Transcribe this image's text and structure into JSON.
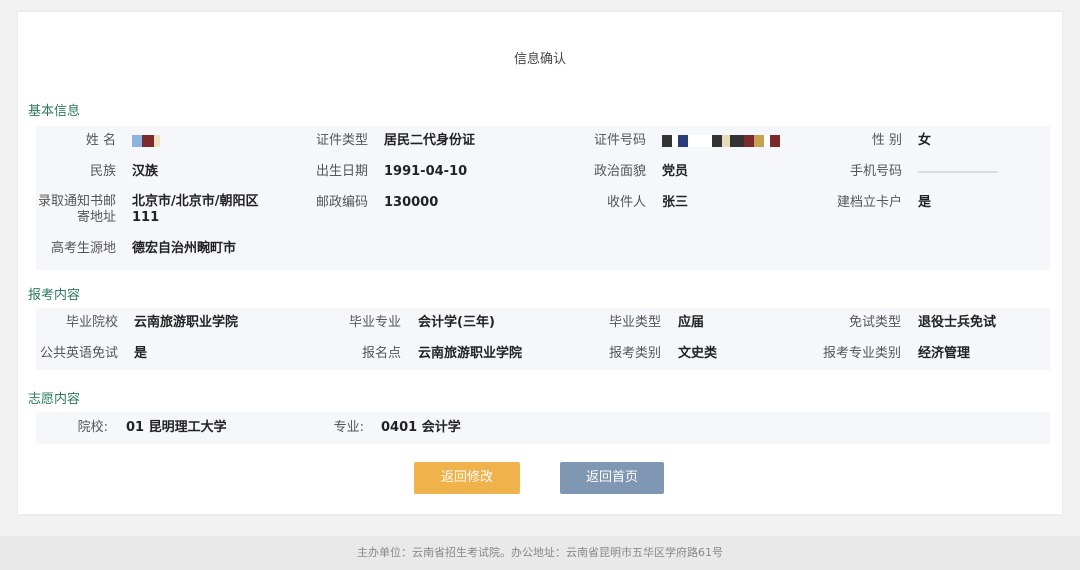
{
  "page_title": "信息确认",
  "sections": {
    "basic": "基本信息",
    "exam": "报考内容",
    "wish": "志愿内容"
  },
  "basic": {
    "name_label": "姓 名",
    "id_type_label": "证件类型",
    "id_type": "居民二代身份证",
    "id_no_label": "证件号码",
    "gender_label": "性 别",
    "gender": "女",
    "ethnic_label": "民族",
    "ethnic": "汉族",
    "birth_label": "出生日期",
    "birth": "1991-04-10",
    "politics_label": "政治面貌",
    "politics": "党员",
    "phone_label": "手机号码",
    "addr_label": "录取通知书邮寄地址",
    "addr": "北京市/北京市/朝阳区 111",
    "zip_label": "邮政编码",
    "zip": "130000",
    "recipient_label": "收件人",
    "recipient": "张三",
    "card_label": "建档立卡户",
    "card": "是",
    "origin_label": "高考生源地",
    "origin": "德宏自治州畹町市"
  },
  "exam": {
    "school_label": "毕业院校",
    "school": "云南旅游职业学院",
    "major_label": "毕业专业",
    "major": "会计学(三年)",
    "grad_type_label": "毕业类型",
    "grad_type": "应届",
    "exempt_label": "免试类型",
    "exempt": "退役士兵免试",
    "english_label": "公共英语免试",
    "english": "是",
    "site_label": "报名点",
    "site": "云南旅游职业学院",
    "category_label": "报考类别",
    "category": "文史类",
    "major_cat_label": "报考专业类别",
    "major_cat": "经济管理"
  },
  "wish": {
    "college_label": "院校:",
    "college": "01 昆明理工大学",
    "major_label": "专业:",
    "major": "0401 会计学"
  },
  "buttons": {
    "back_edit": "返回修改",
    "back_home": "返回首页"
  },
  "footer": "主办单位：云南省招生考试院。办公地址：云南省昆明市五华区学府路61号",
  "colors": {
    "section": "#2a7a5a",
    "btn_edit": "#f0b24a",
    "btn_home": "#7f97b3"
  }
}
